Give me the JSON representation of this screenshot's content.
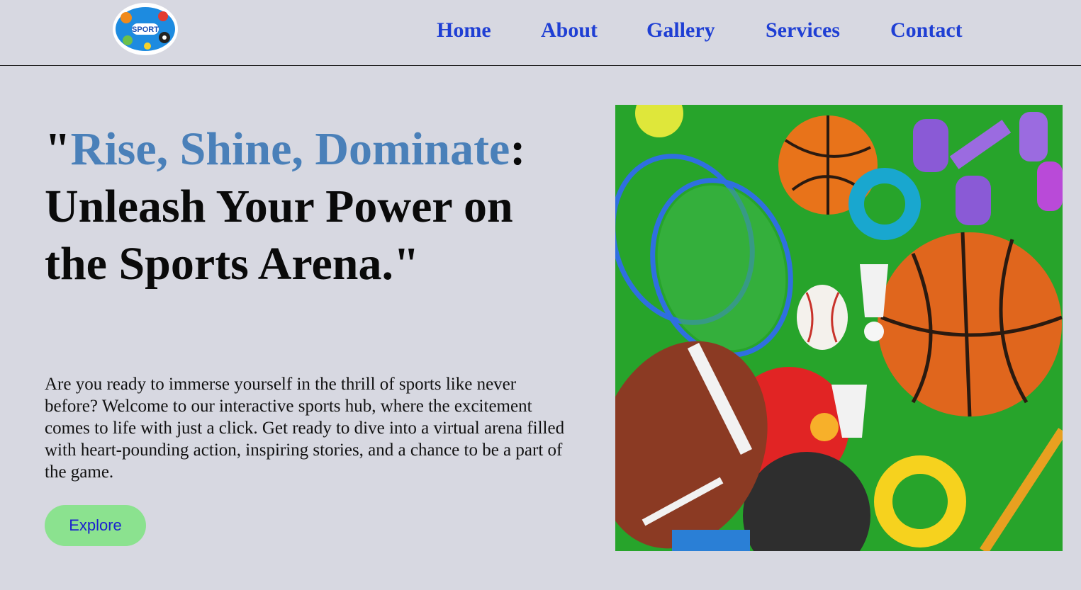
{
  "header": {
    "logo": {
      "icon": "sport-logo-icon",
      "text": "SPORT"
    },
    "nav": [
      {
        "label": "Home"
      },
      {
        "label": "About"
      },
      {
        "label": "Gallery"
      },
      {
        "label": "Services"
      },
      {
        "label": "Contact"
      }
    ]
  },
  "hero": {
    "title_open_quote": "\"",
    "title_accent": "Rise, Shine, Dominate",
    "title_rest": ": Unleash Your Power on the Sports Arena.\"",
    "paragraph": "Are you ready to immerse yourself in the thrill of sports like never before? Welcome to our interactive sports hub, where the excitement comes to life with just a click. Get ready to dive into a virtual arena filled with heart-pounding action, inspiring stories, and a chance to be a part of the game.",
    "button_label": "Explore",
    "image": {
      "icon": "sports-equipment-image"
    }
  },
  "colors": {
    "background": "#d7d8e1",
    "nav_link": "#1f3fd4",
    "title_accent": "#4a80b9",
    "button_bg": "#8be28f",
    "button_text": "#1b1fcf"
  }
}
